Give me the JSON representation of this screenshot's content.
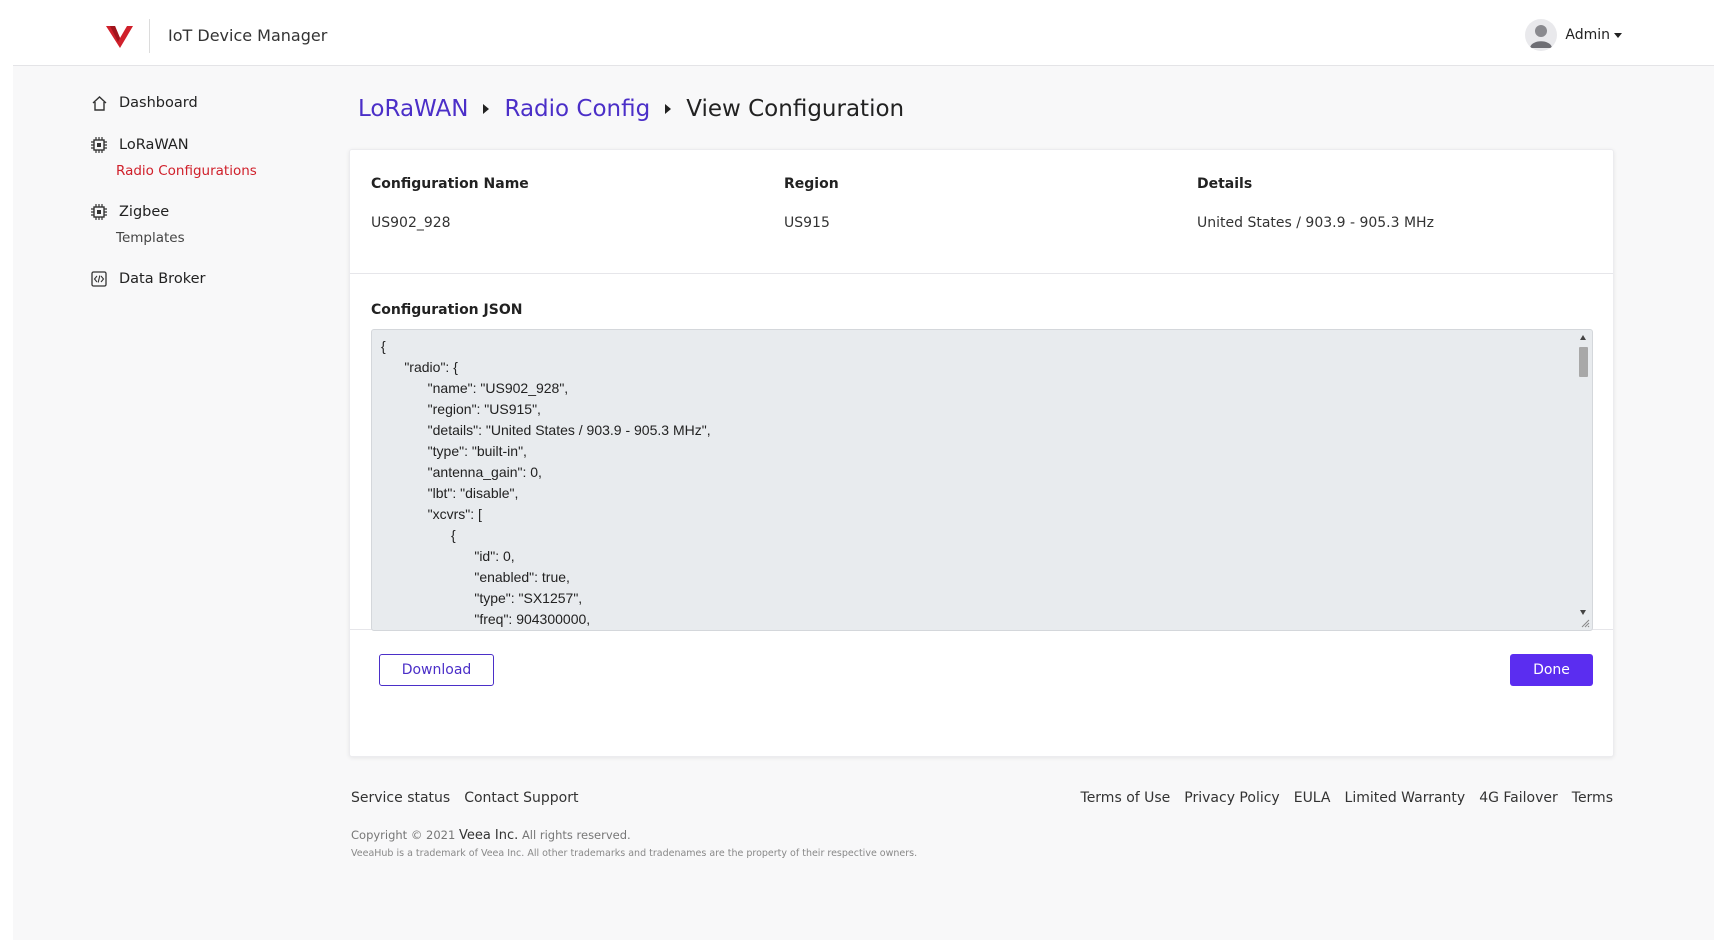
{
  "header": {
    "app_title": "IoT Device Manager",
    "user_name": "Admin",
    "brand_color": "#d0202b"
  },
  "sidebar": {
    "items": [
      {
        "label": "Dashboard",
        "icon": "home-icon"
      },
      {
        "label": "LoRaWAN",
        "icon": "chip-icon",
        "sub": "Radio Configurations"
      },
      {
        "label": "Zigbee",
        "icon": "chip-icon",
        "sub": "Templates"
      },
      {
        "label": "Data Broker",
        "icon": "code-box-icon"
      }
    ]
  },
  "breadcrumb": {
    "items": [
      "LoRaWAN",
      "Radio Config"
    ],
    "current": "View Configuration"
  },
  "config": {
    "name_header": "Configuration Name",
    "name_value": "US902_928",
    "region_header": "Region",
    "region_value": "US915",
    "details_header": "Details",
    "details_value": "United States / 903.9 - 905.3 MHz",
    "json_label": "Configuration JSON",
    "json_text": "{\n      \"radio\": {\n            \"name\": \"US902_928\",\n            \"region\": \"US915\",\n            \"details\": \"United States / 903.9 - 905.3 MHz\",\n            \"type\": \"built-in\",\n            \"antenna_gain\": 0,\n            \"lbt\": \"disable\",\n            \"xcvrs\": [\n                  {\n                        \"id\": 0,\n                        \"enabled\": true,\n                        \"type\": \"SX1257\",\n                        \"freq\": 904300000,"
  },
  "actions": {
    "download_label": "Download",
    "done_label": "Done",
    "accent_color": "#5b2df0"
  },
  "footer": {
    "left_links": [
      "Service status",
      "Contact Support"
    ],
    "right_links": [
      "Terms of Use",
      "Privacy Policy",
      "EULA",
      "Limited Warranty",
      "4G Failover",
      "Terms"
    ],
    "copyright_prefix": "Copyright © 2021",
    "copyright_brand": "Veea Inc.",
    "copyright_suffix": "All rights reserved.",
    "trademark": "VeeaHub is a trademark of Veea Inc. All other trademarks and tradenames are the property of their respective owners."
  }
}
